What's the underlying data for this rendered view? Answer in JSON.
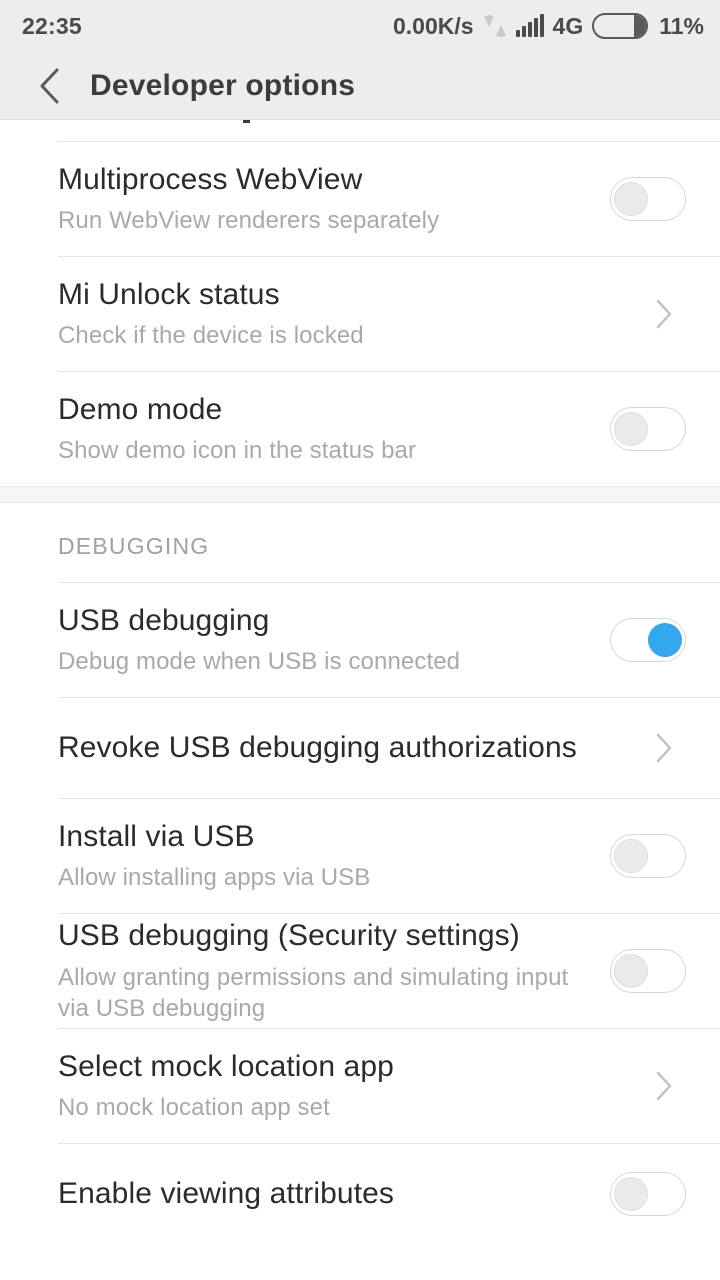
{
  "statusbar": {
    "time": "22:35",
    "net_speed": "0.00K/s",
    "data_icon": "data-transfer-icon",
    "signal_icon": "signal-bars-icon",
    "network_type": "4G",
    "battery_icon": "battery-icon",
    "battery_percent": "11%"
  },
  "header": {
    "back_icon": "back-chevron-icon",
    "title": "Developer options"
  },
  "list": {
    "rows": [
      {
        "title": "Multiprocess WebView",
        "subtitle": "Run WebView renderers separately",
        "control": "toggle",
        "state": "off"
      },
      {
        "title": "Mi Unlock status",
        "subtitle": "Check if the device is locked",
        "control": "chevron",
        "state": ""
      },
      {
        "title": "Demo mode",
        "subtitle": "Show demo icon in the status bar",
        "control": "toggle",
        "state": "off"
      }
    ],
    "section_debugging": "DEBUGGING",
    "debug_rows": [
      {
        "title": "USB debugging",
        "subtitle": "Debug mode when USB is connected",
        "control": "toggle",
        "state": "on"
      },
      {
        "title": "Revoke USB debugging authorizations",
        "subtitle": "",
        "control": "chevron",
        "state": ""
      },
      {
        "title": "Install via USB",
        "subtitle": "Allow installing apps via USB",
        "control": "toggle",
        "state": "off"
      },
      {
        "title": "USB debugging (Security settings)",
        "subtitle": "Allow granting permissions and simulating input via USB debugging",
        "control": "toggle",
        "state": "off"
      },
      {
        "title": "Select mock location app",
        "subtitle": "No mock location app set",
        "control": "chevron",
        "state": ""
      },
      {
        "title": "Enable viewing attributes",
        "subtitle": "",
        "control": "toggle",
        "state": "off"
      }
    ]
  },
  "colors": {
    "accent": "#33a8ef",
    "bar_bg": "#ededed",
    "title_text": "#3c3c3c",
    "row_title": "#2b2b2b",
    "row_sub": "#a9a9a9",
    "divider": "#e4e4e4"
  }
}
